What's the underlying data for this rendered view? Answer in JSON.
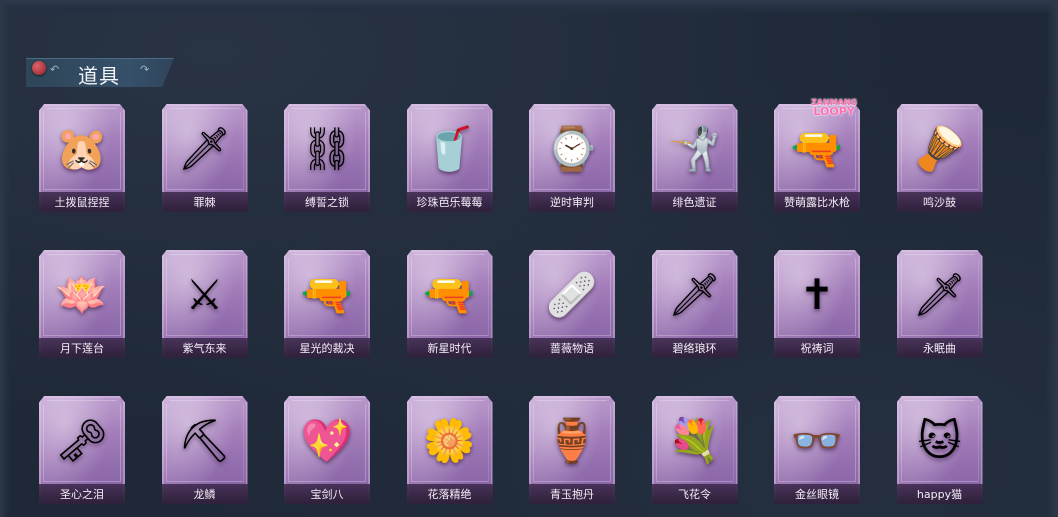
{
  "section": {
    "title": "道具"
  },
  "badge": {
    "line1": "ZANMANG",
    "line2": "LOOPY"
  },
  "items": [
    {
      "name": "土拨鼠捏捏",
      "icon": "hamster-plush-icon",
      "glyph": "🐹"
    },
    {
      "name": "罪棘",
      "icon": "thorn-spear-icon",
      "glyph": "🗡"
    },
    {
      "name": "缚誓之锁",
      "icon": "chain-lock-icon",
      "glyph": "⛓"
    },
    {
      "name": "珍珠芭乐莓莓",
      "icon": "bubble-tea-icon",
      "glyph": "🥤"
    },
    {
      "name": "逆时审判",
      "icon": "pocket-watch-icon",
      "glyph": "⌚"
    },
    {
      "name": "绯色遗证",
      "icon": "rapier-icon",
      "glyph": "🤺"
    },
    {
      "name": "赞萌露比水枪",
      "icon": "water-gun-icon",
      "glyph": "🔫"
    },
    {
      "name": "鸣沙鼓",
      "icon": "dreamcatcher-drum-icon",
      "glyph": "🪘"
    },
    {
      "name": "月下莲台",
      "icon": "lotus-scepter-icon",
      "glyph": "🪷"
    },
    {
      "name": "紫气东来",
      "icon": "curved-blade-icon",
      "glyph": "⚔"
    },
    {
      "name": "星光的裁决",
      "icon": "flintlock-pistol-icon",
      "glyph": "🔫"
    },
    {
      "name": "新星时代",
      "icon": "revolver-icon",
      "glyph": "🔫"
    },
    {
      "name": "蔷薇物语",
      "icon": "medical-kit-icon",
      "glyph": "🩹"
    },
    {
      "name": "碧络琅环",
      "icon": "jade-sword-icon",
      "glyph": "🗡"
    },
    {
      "name": "祝祷词",
      "icon": "golden-cross-icon",
      "glyph": "✝"
    },
    {
      "name": "永眠曲",
      "icon": "violet-sword-icon",
      "glyph": "🗡"
    },
    {
      "name": "圣心之泪",
      "icon": "ruby-key-icon",
      "glyph": "🗝"
    },
    {
      "name": "龙鳞",
      "icon": "golden-shovel-icon",
      "glyph": "⛏"
    },
    {
      "name": "宝剑八",
      "icon": "heart-shield-icon",
      "glyph": "💖"
    },
    {
      "name": "花落精绝",
      "icon": "flower-pendant-icon",
      "glyph": "🌼"
    },
    {
      "name": "青玉抱丹",
      "icon": "potion-vase-icon",
      "glyph": "🏺"
    },
    {
      "name": "飞花令",
      "icon": "flower-bouquet-icon",
      "glyph": "💐"
    },
    {
      "name": "金丝眼镜",
      "icon": "glasses-icon",
      "glyph": "👓"
    },
    {
      "name": "happy猫",
      "icon": "cat-figure-icon",
      "glyph": "🐱"
    }
  ]
}
